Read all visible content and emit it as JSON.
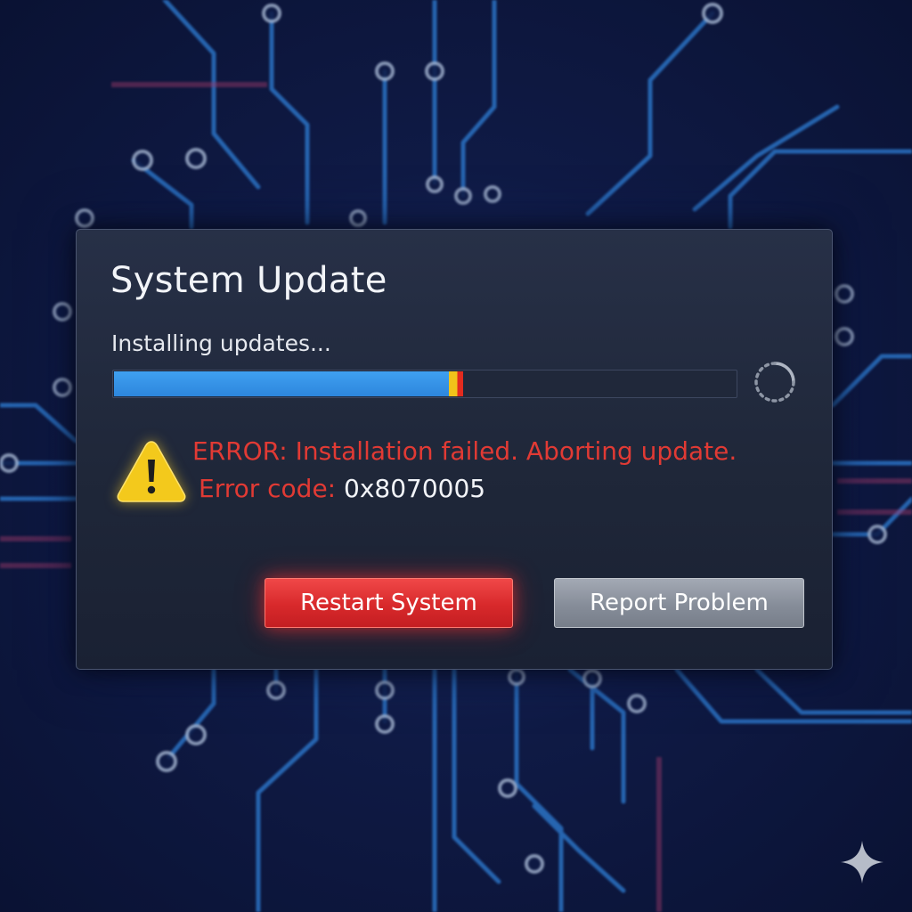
{
  "dialog": {
    "title": "System Update",
    "status": "Installing updates...",
    "progress": {
      "fraction": 0.56,
      "state": "error"
    },
    "error": {
      "message": "ERROR: Installation failed. Aborting update.",
      "code_label": "Error code:",
      "code_value": "0x8070005"
    },
    "buttons": {
      "restart_label": "Restart System",
      "report_label": "Report Problem"
    }
  },
  "icons": {
    "warning": "warning-triangle-icon",
    "spinner": "loading-spinner-icon",
    "sparkle": "sparkle-icon"
  },
  "colors": {
    "background": "#0f1a45",
    "circuit_trace": "#2f7fd6",
    "dialog": "#232b3e",
    "progress_fill": "#2d86dd",
    "error_text": "#e13a34",
    "warning": "#f3c91c",
    "restart_button": "#d8292b",
    "report_button": "#868d99"
  }
}
